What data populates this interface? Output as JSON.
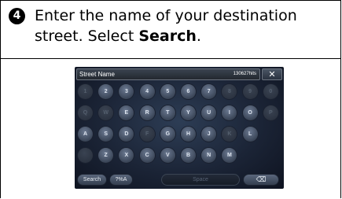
{
  "instruction": {
    "step_number": "4",
    "text_before": "Enter the name of your destination street. Select ",
    "text_bold": "Search",
    "text_after": "."
  },
  "screen": {
    "input": {
      "placeholder": "Street Name",
      "hits": "130627hits"
    },
    "close_icon": "✕",
    "rows": [
      [
        "1",
        "2",
        "3",
        "4",
        "5",
        "6",
        "7",
        "8",
        "9",
        "0"
      ],
      [
        "Q",
        "W",
        "E",
        "R",
        "T",
        "Y",
        "U",
        "I",
        "O",
        "P"
      ],
      [
        "A",
        "S",
        "D",
        "F",
        "G",
        "H",
        "J",
        "K",
        "L"
      ],
      [
        "",
        "Z",
        "X",
        "C",
        "V",
        "B",
        "N",
        "M"
      ]
    ],
    "dim_keys": [
      "1",
      "Q",
      "W",
      "8",
      "9",
      "0",
      "P",
      "F",
      "K"
    ],
    "bottom": {
      "search_label": "Search",
      "symbols_label": "?%A",
      "space_label": "Space",
      "delete_icon": "⌫"
    }
  }
}
